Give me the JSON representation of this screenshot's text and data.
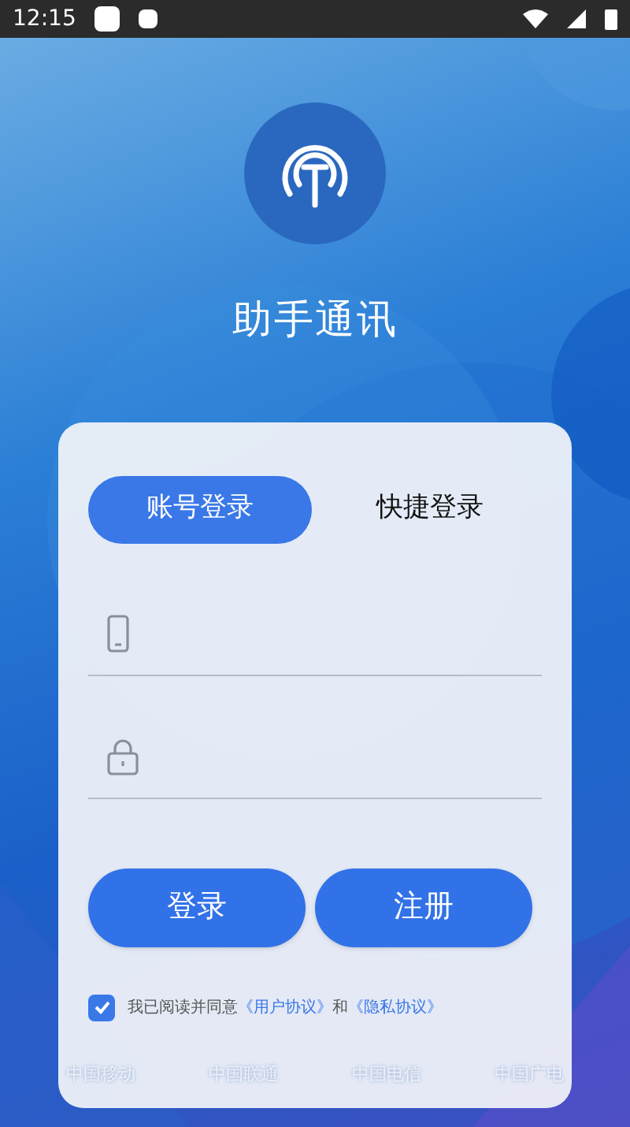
{
  "status_bar": {
    "time": "12:15"
  },
  "app": {
    "title": "助手通讯"
  },
  "tabs": [
    {
      "label": "账号登录",
      "selected": true
    },
    {
      "label": "快捷登录",
      "selected": false
    }
  ],
  "fields": [
    {
      "kind": "phone"
    },
    {
      "kind": "password"
    }
  ],
  "buttons": [
    "登录",
    "注册"
  ],
  "agreement": {
    "checked": true,
    "parts": [
      {
        "kind": "text",
        "text": "我已阅读并同意"
      },
      {
        "kind": "link",
        "text": "《用户协议》"
      },
      {
        "kind": "text",
        "text": "和"
      },
      {
        "kind": "link",
        "text": "《隐私协议》"
      }
    ]
  },
  "carriers": [
    "中国移动",
    "中国联通",
    "中国电信",
    "中国广电"
  ]
}
